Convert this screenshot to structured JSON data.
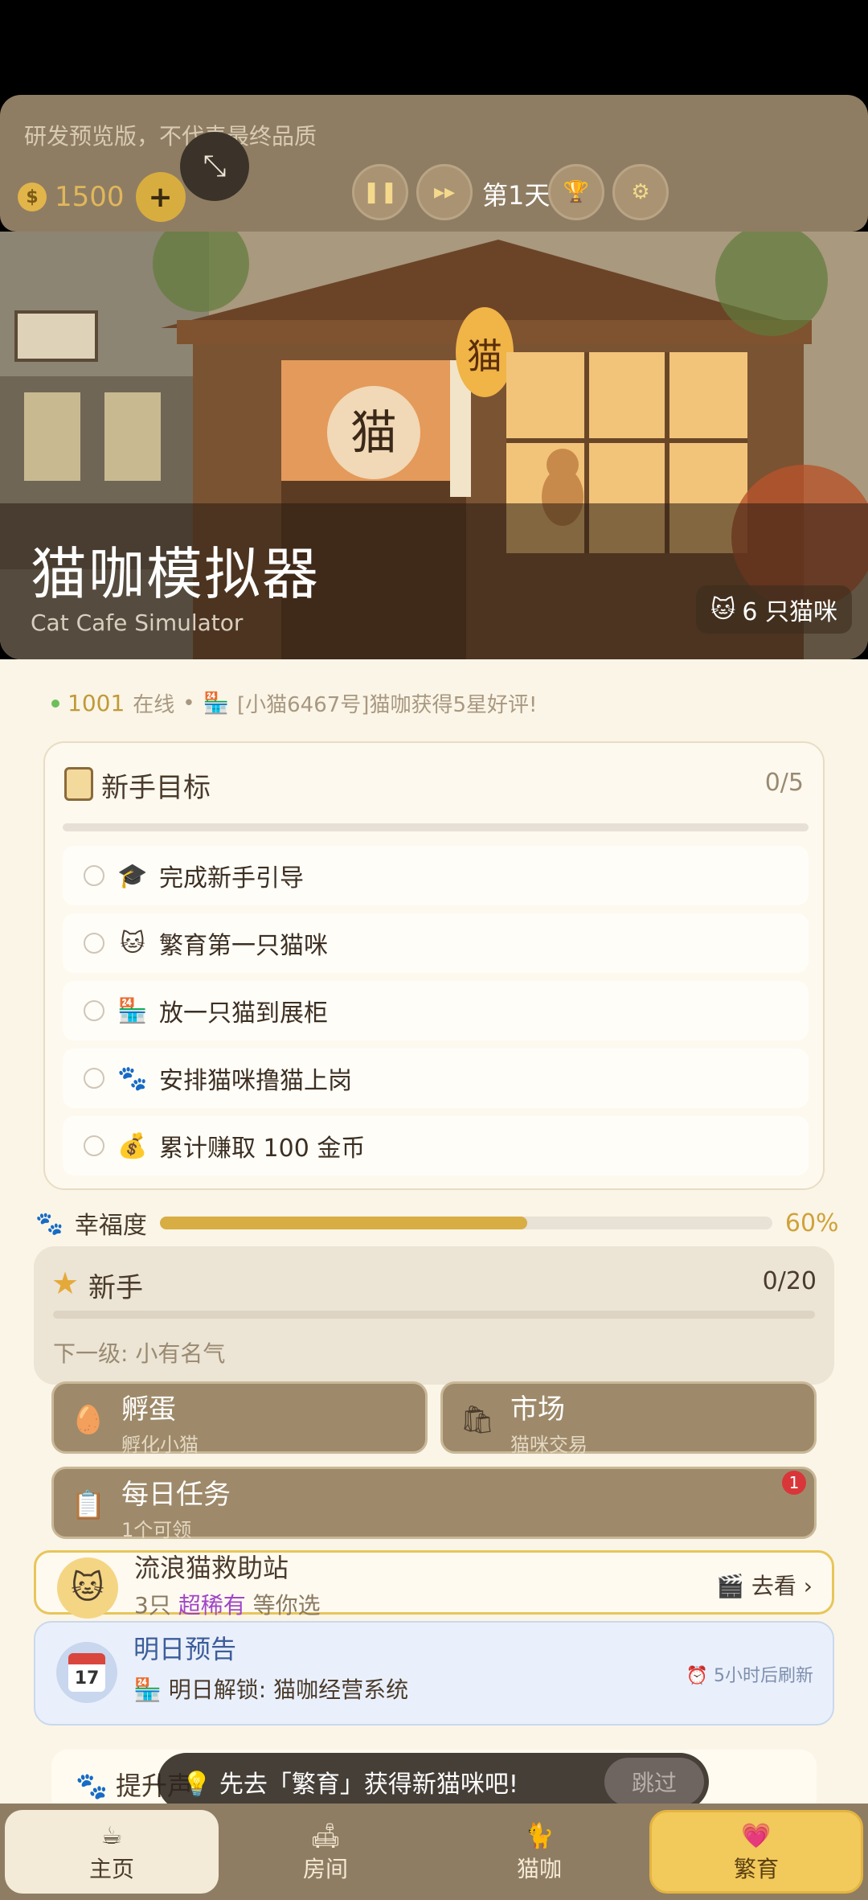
{
  "topbar": {
    "dev_note": "研发预览版，不代表最终品质",
    "coins": "1500",
    "day": "第1天"
  },
  "hero": {
    "title": "猫咖模拟器",
    "subtitle": "Cat Cafe Simulator",
    "cat_count": "6 只猫咪",
    "sign_left": "猫",
    "sign_lantern": "猫"
  },
  "ticker": {
    "online_count": "1001",
    "online_label": "在线",
    "message": "[小猫6467号]猫咖获得5星好评!"
  },
  "goals": {
    "title": "新手目标",
    "progress": "0/5",
    "items": [
      {
        "icon": "graduation-cap",
        "emoji": "🎓",
        "label": "完成新手引导"
      },
      {
        "icon": "cat-face",
        "emoji": "🐱",
        "label": "繁育第一只猫咪"
      },
      {
        "icon": "convenience-store",
        "emoji": "🏪",
        "label": "放一只猫到展柜"
      },
      {
        "icon": "paw-prints",
        "emoji": "🐾",
        "label": "安排猫咪撸猫上岗"
      },
      {
        "icon": "money-bag",
        "emoji": "💰",
        "label": "累计赚取 100 金币"
      }
    ]
  },
  "happiness": {
    "label": "幸福度",
    "value": 0.6,
    "value_text": "60%"
  },
  "rank": {
    "title": "新手",
    "progress": "0/20",
    "next_level": "下一级: 小有名气"
  },
  "tiles": {
    "hatch": {
      "title": "孵蛋",
      "subtitle": "孵化小猫",
      "icon": "egg"
    },
    "market": {
      "title": "市场",
      "subtitle": "猫咪交易",
      "icon": "shopping-bag"
    },
    "daily": {
      "title": "每日任务",
      "subtitle": "1个可领",
      "icon": "clipboard",
      "badge": "1"
    }
  },
  "rescue": {
    "title": "流浪猫救助站",
    "sub_prefix": "3只",
    "sub_rare": "超稀有",
    "sub_suffix": "等你选",
    "action": "去看 ›"
  },
  "preview": {
    "title": "明日预告",
    "subtitle": "明日解锁: 猫咖经营系统",
    "refresh": "5小时后刷新",
    "calendar_day": "17"
  },
  "boost": {
    "text": "提升声"
  },
  "toast": {
    "text": "先去「繁育」获得新猫咪吧!",
    "skip": "跳过"
  },
  "nav": {
    "home": "主页",
    "room": "房间",
    "cafe": "猫咖",
    "breed": "繁育"
  },
  "colors": {
    "topbar": "#8f7d63",
    "accent_gold": "#d7ad44",
    "page_bg": "#fbf5e7",
    "rare_purple": "#a046c8",
    "badge_red": "#d9363a"
  }
}
